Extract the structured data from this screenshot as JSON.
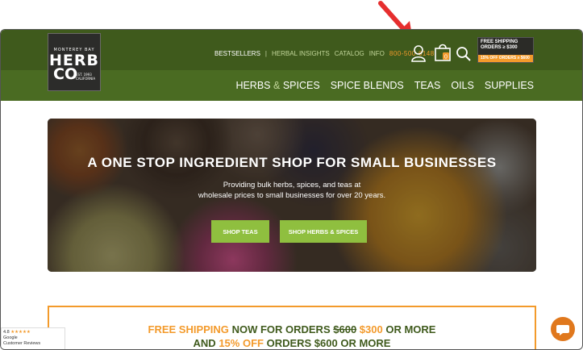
{
  "brand": {
    "line1": "MONTEREY BAY",
    "line2": "HERB",
    "line3": "CO",
    "line4": "EST. 1993\nCALIFORNIA"
  },
  "toplinks": {
    "bestsellers": "BESTSELLERS",
    "sep": "|",
    "herbal_insights": "HERBAL INSIGHTS",
    "catalog": "CATALOG",
    "info": "INFO",
    "phone": "800-500-6148"
  },
  "cart": {
    "count": "0"
  },
  "shipping_badge": {
    "line1": "FREE SHIPPING",
    "line2": "ORDERS ≥ $300",
    "line3": "15% OFF ORDERS ≥ $600"
  },
  "nav": {
    "herbs": "HERBS",
    "amp": "&",
    "spices": "SPICES",
    "spice_blends": "SPICE BLENDS",
    "teas": "TEAS",
    "oils": "OILS",
    "supplies": "SUPPLIES"
  },
  "hero": {
    "title": "A ONE STOP INGREDIENT SHOP FOR SMALL BUSINESSES",
    "sub1": "Providing bulk herbs, spices, and teas at",
    "sub2": "wholesale prices to small businesses for over 20 years.",
    "btn_teas": "SHOP TEAS",
    "btn_herbs": "SHOP HERBS & SPICES"
  },
  "promo": {
    "free_shipping": "FREE SHIPPING",
    "now_for": "NOW FOR ORDERS",
    "old_price": "$600",
    "new_price": "$300",
    "or_more1": "OR MORE",
    "and": "AND",
    "pct_off": "15% OFF",
    "orders_600": "ORDERS $600 OR MORE"
  },
  "rating": {
    "score": "4.8",
    "stars": "★★★★★",
    "source": "Google",
    "label": "Customer Reviews"
  },
  "colors": {
    "dark_green": "#3f5a1c",
    "nav_green": "#4a6b22",
    "accent_orange": "#f39a2b",
    "button_green": "#8fbf3f",
    "arrow_red": "#e62e2e"
  }
}
